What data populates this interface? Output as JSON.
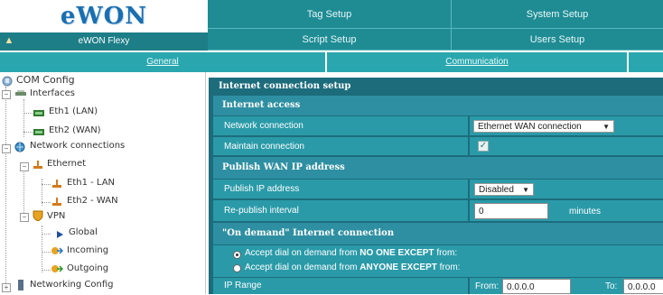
{
  "header": {
    "logo_text": "eWON",
    "device_name": "eWON Flexy",
    "nav": {
      "tag_setup": "Tag Setup",
      "system_setup": "System Setup",
      "script_setup": "Script Setup",
      "users_setup": "Users Setup"
    }
  },
  "tabs": {
    "general": "General",
    "communication": "Communication"
  },
  "tree": {
    "root": "COM Config",
    "interfaces": "Interfaces",
    "eth1": "Eth1 (LAN)",
    "eth2": "Eth2 (WAN)",
    "network_connections": "Network connections",
    "ethernet": "Ethernet",
    "eth1_lan": "Eth1 - LAN",
    "eth2_wan": "Eth2 - WAN",
    "vpn": "VPN",
    "global": "Global",
    "incoming": "Incoming",
    "outgoing": "Outgoing",
    "networking_config": "Networking Config"
  },
  "panel": {
    "title": "Internet connection setup",
    "internet_access": {
      "heading": "Internet access",
      "network_connection_label": "Network connection",
      "network_connection_value": "Ethernet WAN connection",
      "maintain_connection_label": "Maintain connection",
      "maintain_connection_checked": true
    },
    "publish_wan": {
      "heading": "Publish WAN IP address",
      "publish_ip_label": "Publish IP address",
      "publish_ip_value": "Disabled",
      "republish_label": "Re-publish interval",
      "republish_value": "0",
      "republish_unit": "minutes"
    },
    "on_demand": {
      "heading": "\"On demand\" Internet connection",
      "option1_prefix": "Accept dial on demand from ",
      "option1_bold": "NO ONE EXCEPT",
      "option1_suffix": " from:",
      "option2_prefix": "Accept dial on demand from ",
      "option2_bold": "ANYONE EXCEPT",
      "option2_suffix": " from:",
      "ip_range_label": "IP Range",
      "from_label": "From:",
      "from_value": "0.0.0.0",
      "to_label": "To:",
      "to_value": "0.0.0.0"
    }
  }
}
